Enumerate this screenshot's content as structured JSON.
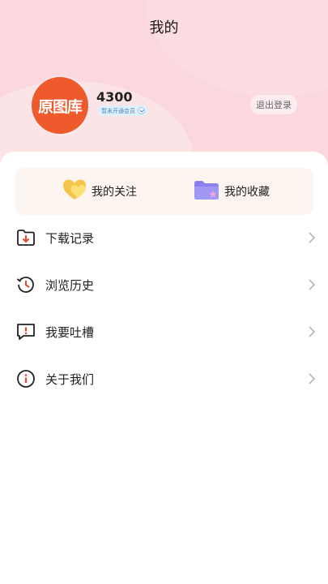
{
  "header": {
    "title": "我的"
  },
  "profile": {
    "avatar_text": "原图库",
    "username": "4300",
    "vip_status": "暂未开通会员",
    "logout_label": "退出登录"
  },
  "quick_links": {
    "follow_label": "我的关注",
    "collect_label": "我的收藏"
  },
  "menu": [
    {
      "label": "下载记录",
      "icon": "download-folder-icon"
    },
    {
      "label": "浏览历史",
      "icon": "history-icon"
    },
    {
      "label": "我要吐槽",
      "icon": "feedback-icon"
    },
    {
      "label": "关于我们",
      "icon": "info-icon"
    }
  ],
  "colors": {
    "header_pink": "#fbd8dd",
    "avatar_orange": "#ee5a2c",
    "accent_red": "#e8452c",
    "quick_bg": "#fdf5ef"
  }
}
